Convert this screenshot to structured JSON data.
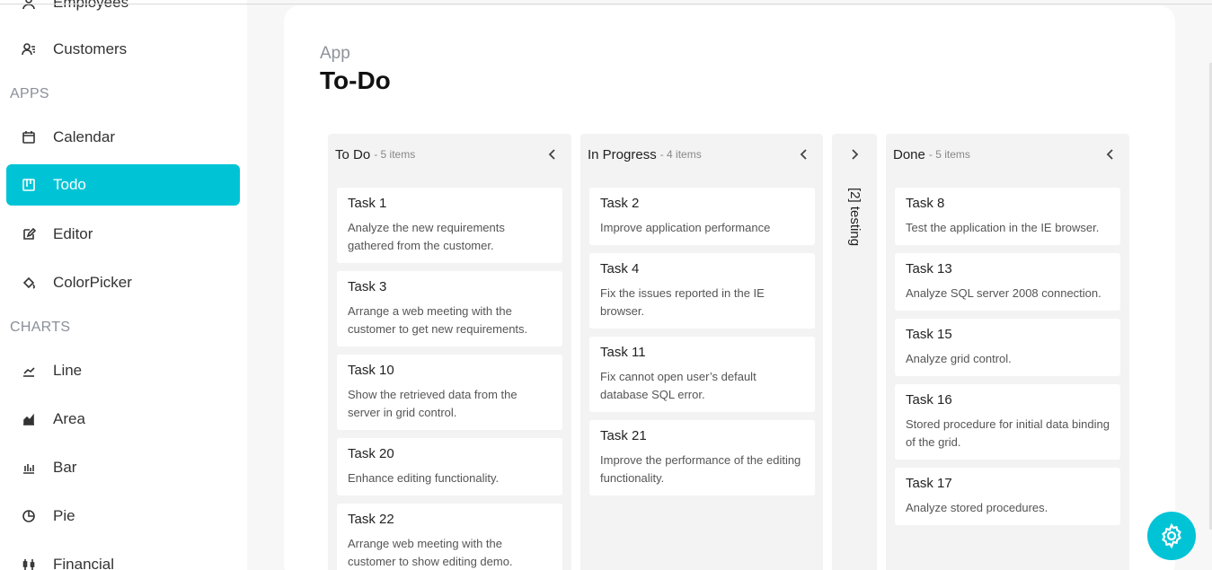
{
  "sidebar": {
    "items": [
      {
        "label": "Employees",
        "icon": "person-icon"
      },
      {
        "label": "Customers",
        "icon": "customers-icon"
      },
      {
        "label": "Calendar",
        "icon": "calendar-icon"
      },
      {
        "label": "Todo",
        "icon": "kanban-icon"
      },
      {
        "label": "Editor",
        "icon": "edit-icon"
      },
      {
        "label": "ColorPicker",
        "icon": "paint-bucket-icon"
      },
      {
        "label": "Line",
        "icon": "line-chart-icon"
      },
      {
        "label": "Area",
        "icon": "area-chart-icon"
      },
      {
        "label": "Bar",
        "icon": "bar-chart-icon"
      },
      {
        "label": "Pie",
        "icon": "pie-chart-icon"
      },
      {
        "label": "Financial",
        "icon": "financial-chart-icon"
      }
    ],
    "sections": {
      "apps": "APPS",
      "charts": "CHARTS"
    },
    "active_color": "#00c4d6"
  },
  "header": {
    "breadcrumb": "App",
    "title": "To-Do"
  },
  "kanban": {
    "columns": [
      {
        "title": "To Do",
        "count": "- 5 items",
        "cards": [
          {
            "title": "Task 1",
            "text": "Analyze the new requirements gathered from the customer."
          },
          {
            "title": "Task 3",
            "text": "Arrange a web meeting with the customer to get new requirements."
          },
          {
            "title": "Task 10",
            "text": "Show the retrieved data from the server in grid control."
          },
          {
            "title": "Task 20",
            "text": "Enhance editing functionality."
          },
          {
            "title": "Task 22",
            "text": "Arrange web meeting with the customer to show editing demo."
          }
        ]
      },
      {
        "title": "In Progress",
        "count": "- 4 items",
        "cards": [
          {
            "title": "Task 2",
            "text": "Improve application performance"
          },
          {
            "title": "Task 4",
            "text": "Fix the issues reported in the IE browser."
          },
          {
            "title": "Task 11",
            "text": "Fix cannot open user’s default database SQL error."
          },
          {
            "title": "Task 21",
            "text": "Improve the performance of the editing functionality."
          }
        ]
      },
      {
        "title": "Done",
        "count": "- 5 items",
        "cards": [
          {
            "title": "Task 8",
            "text": "Test the application in the IE browser."
          },
          {
            "title": "Task 13",
            "text": "Analyze SQL server 2008 connection."
          },
          {
            "title": "Task 15",
            "text": "Analyze grid control."
          },
          {
            "title": "Task 16",
            "text": "Stored procedure for initial data binding of the grid."
          },
          {
            "title": "Task 17",
            "text": "Analyze stored procedures."
          }
        ]
      }
    ],
    "collapsed": {
      "label": "[2] testing"
    }
  },
  "fab": {
    "icon": "gear-icon",
    "color": "#00c4d6"
  }
}
